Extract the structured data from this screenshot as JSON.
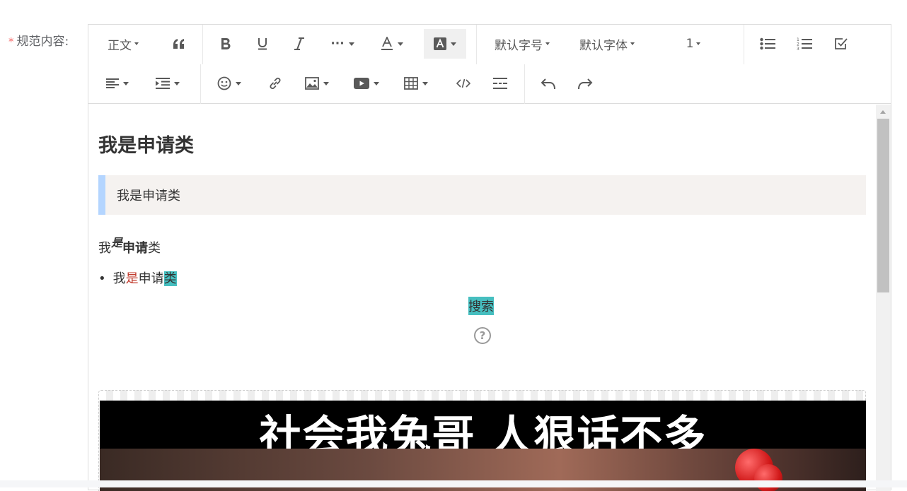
{
  "form": {
    "required_mark": "*",
    "label": "规范内容:"
  },
  "toolbar": {
    "paragraph": "正文",
    "font_size": "默认字号",
    "font_family": "默认字体",
    "line_height": "1",
    "more": "···"
  },
  "content": {
    "heading": "我是申请类",
    "blockquote": "我是申请类",
    "mixed": {
      "p1": "我",
      "p2": "是",
      "p3": "申请",
      "p4": "类"
    },
    "bullet": {
      "marker": "•",
      "p1": "我",
      "p2": "是",
      "p3": "申请",
      "p4": "类"
    },
    "search_text": "搜索",
    "help_glyph": "?",
    "image_caption": "社会我兔哥 人狠话不多"
  },
  "colors": {
    "highlight": "#46bfc0",
    "red_text": "#c0392b",
    "quote_bar": "#b4d5ff",
    "quote_bg": "#f5f2f0"
  }
}
